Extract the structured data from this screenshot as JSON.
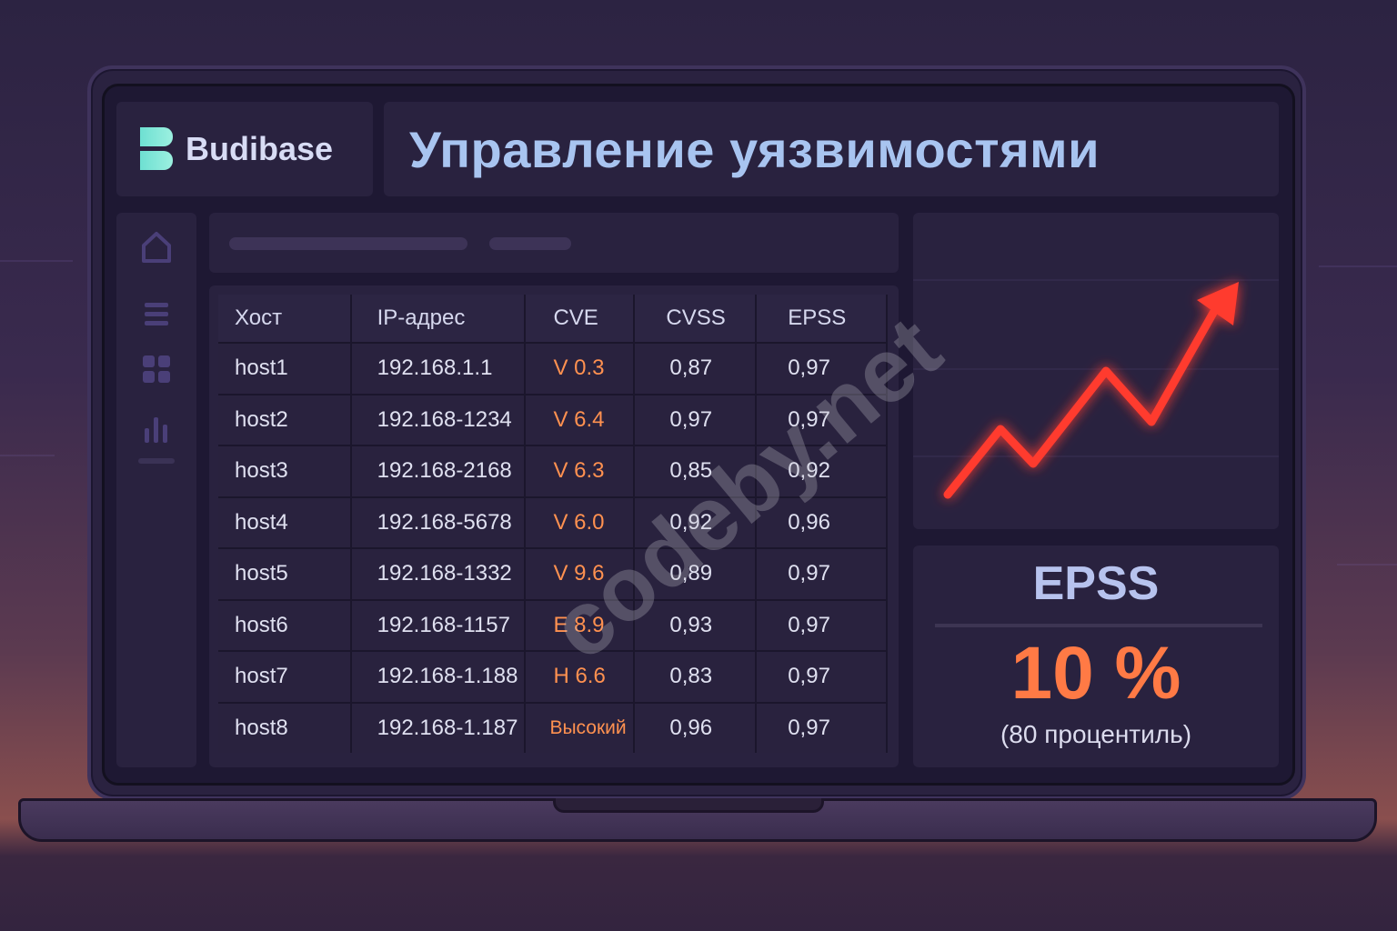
{
  "brand": {
    "name": "Budibase",
    "logo_icon": "budibase-logo"
  },
  "header": {
    "title": "Управление уязвимостями"
  },
  "sidebar": {
    "icons": [
      "home-icon",
      "list-icon",
      "grid-icon",
      "bar-chart-icon"
    ]
  },
  "table": {
    "headers": [
      "Хост",
      "IP-адрес",
      "CVE",
      "CVSS",
      "EPSS"
    ],
    "rows": [
      [
        "host1",
        "192.168.1.1",
        "V 0.3",
        "0,87",
        "0,97"
      ],
      [
        "host2",
        "192.168-1234",
        "V 6.4",
        "0,97",
        "0,97"
      ],
      [
        "host3",
        "192.168-2168",
        "V 6.3",
        "0,85",
        "0,92"
      ],
      [
        "host4",
        "192.168-5678",
        "V 6.0",
        "0,92",
        "0,96"
      ],
      [
        "host5",
        "192.168-1332",
        "V 9.6",
        "0,89",
        "0,97"
      ],
      [
        "host6",
        "192.168-1157",
        "E 8.9",
        "0,93",
        "0,97"
      ],
      [
        "host7",
        "192.168-1.188",
        "H 6.6",
        "0,83",
        "0,97"
      ],
      [
        "host8",
        "192.168-1.187",
        "Высокий",
        "0,96",
        "0,97"
      ]
    ]
  },
  "trend": {
    "icon": "trend-up-arrow-icon",
    "color": "#ff3a2e"
  },
  "epss_card": {
    "title": "EPSS",
    "value": "10 %",
    "caption": "(80 процентиль)"
  },
  "watermark": "codeby.net",
  "colors": {
    "accent": "#ff7a45",
    "cve_text": "#ff9150",
    "title": "#a8c4f0"
  }
}
